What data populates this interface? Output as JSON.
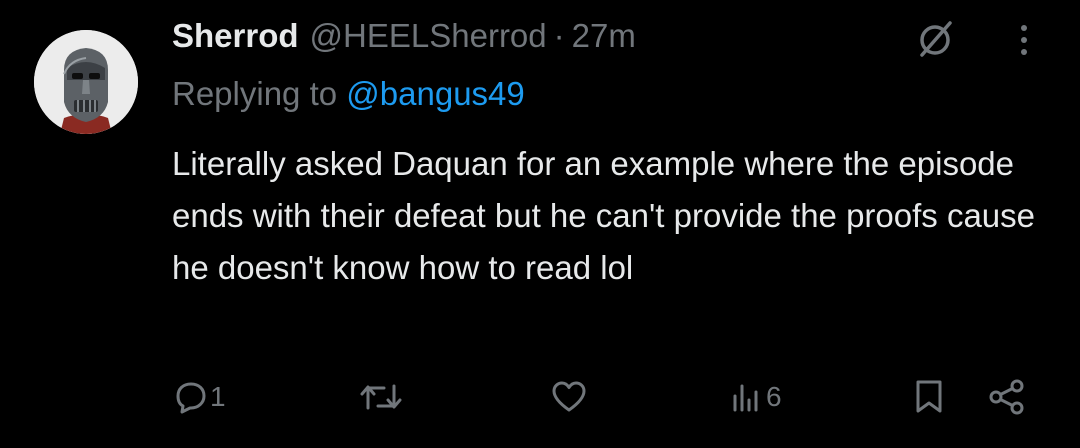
{
  "tweet": {
    "author": {
      "display_name": "Sherrod",
      "handle": "@HEELSherrod",
      "avatar_icon": "masked-figure-avatar"
    },
    "separator": "·",
    "time_ago": "27m",
    "reply_prefix": "Replying to",
    "reply_to_handle": "@bangus49",
    "text": "Literally asked Daquan for an example where the episode ends with their defeat but he can't provide the proofs cause he doesn't know how to read lol",
    "actions": {
      "reply_count": "1",
      "retweet_count": "",
      "like_count": "",
      "views_count": "6"
    },
    "icons": [
      "mute-icon",
      "more-icon",
      "reply-icon",
      "retweet-icon",
      "like-icon",
      "views-icon",
      "bookmark-icon",
      "share-icon"
    ],
    "colors": {
      "background": "#000000",
      "primary_text": "#e7e9ea",
      "secondary_text": "#71767b",
      "link": "#1d9bf0"
    }
  }
}
